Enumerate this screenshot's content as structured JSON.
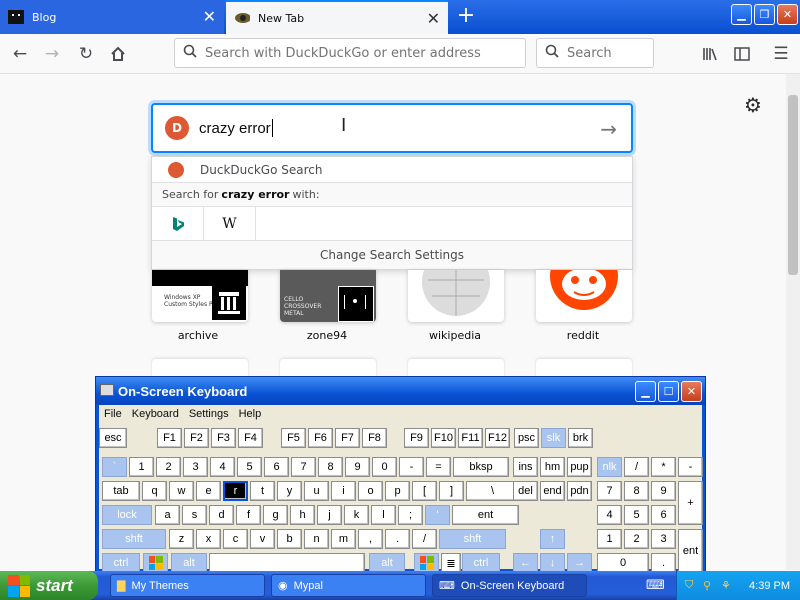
{
  "browser": {
    "tabs": [
      {
        "label": "Blog",
        "active": false
      },
      {
        "label": "New Tab",
        "active": true
      }
    ],
    "urlbar_placeholder": "Search with DuckDuckGo or enter address",
    "searchbar_placeholder": "Search"
  },
  "newtab": {
    "search_value": "crazy error",
    "dropdown": {
      "engine_label": "DuckDuckGo Search",
      "search_for_prefix": "Search for",
      "search_for_term": "crazy error",
      "search_for_suffix": "with:",
      "engines": [
        "bing",
        "wikipedia"
      ],
      "change_settings": "Change Search Settings"
    },
    "tiles": [
      {
        "label": "archive",
        "thumb_text": "Windows XP Custom Styles Pack"
      },
      {
        "label": "zone94",
        "thumb_text": "CELLO CROSSOVER METAL"
      },
      {
        "label": "wikipedia"
      },
      {
        "label": "reddit"
      }
    ]
  },
  "osk": {
    "title": "On-Screen Keyboard",
    "menu": [
      "File",
      "Keyboard",
      "Settings",
      "Help"
    ],
    "rows": {
      "r1": [
        "esc",
        "F1",
        "F2",
        "F3",
        "F4",
        "F5",
        "F6",
        "F7",
        "F8",
        "F9",
        "F10",
        "F11",
        "F12",
        "psc",
        "slk",
        "brk"
      ],
      "r2": [
        "`",
        "1",
        "2",
        "3",
        "4",
        "5",
        "6",
        "7",
        "8",
        "9",
        "0",
        "-",
        "=",
        "bksp",
        "ins",
        "hm",
        "pup",
        "nlk",
        "/",
        "*",
        "-"
      ],
      "r3": [
        "tab",
        "q",
        "w",
        "e",
        "r",
        "t",
        "y",
        "u",
        "i",
        "o",
        "p",
        "[",
        "]",
        "\\",
        "del",
        "end",
        "pdn",
        "7",
        "8",
        "9",
        "+"
      ],
      "r4": [
        "lock",
        "a",
        "s",
        "d",
        "f",
        "g",
        "h",
        "j",
        "k",
        "l",
        ";",
        "'",
        "ent",
        "4",
        "5",
        "6"
      ],
      "r5": [
        "shft",
        "z",
        "x",
        "c",
        "v",
        "b",
        "n",
        "m",
        ",",
        ".",
        "/",
        "shft",
        "1",
        "2",
        "3",
        "ent"
      ],
      "r6": [
        "ctrl",
        "alt",
        "alt",
        "ctrl",
        "0",
        "."
      ]
    },
    "active_key": "r"
  },
  "taskbar": {
    "start_label": "start",
    "tasks": [
      "My Themes",
      "Mypal",
      "On-Screen Keyboard"
    ],
    "clock": "4:39 PM"
  }
}
